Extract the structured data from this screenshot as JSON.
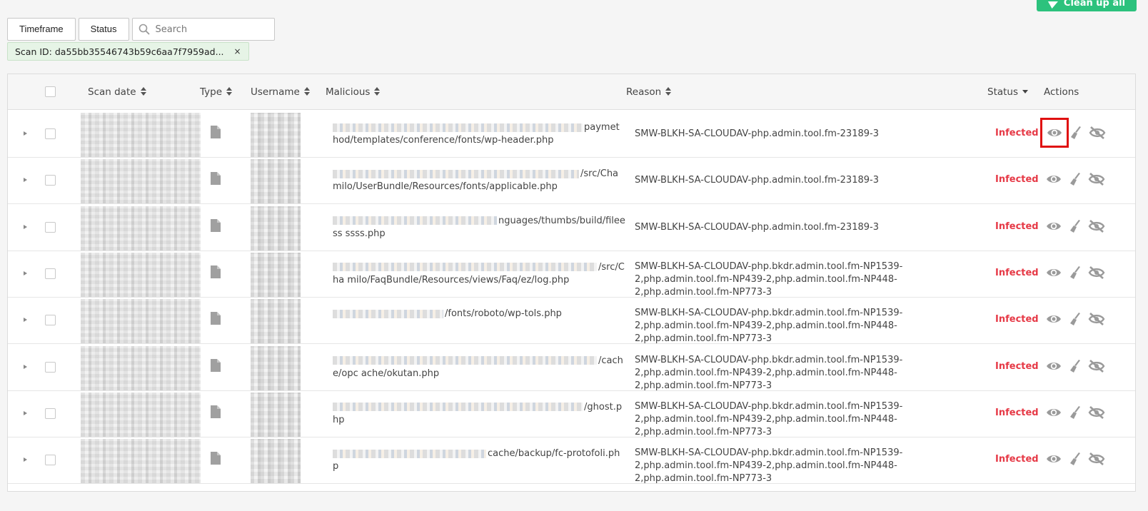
{
  "toolbar": {
    "cleanup_label": "Clean up all",
    "timeframe_label": "Timeframe",
    "status_label": "Status",
    "search_placeholder": "Search"
  },
  "filter_chip": {
    "label": "Scan ID: da55bb35546743b59c6aa7f7959ad...",
    "close": "×"
  },
  "columns": {
    "scan_date": "Scan date",
    "type": "Type",
    "username": "Username",
    "malicious": "Malicious",
    "reason": "Reason",
    "status": "Status",
    "actions": "Actions"
  },
  "rows": [
    {
      "malicious_visible": "paymet hod/templates/conference/fonts/wp-header.php",
      "reason": "SMW-BLKH-SA-CLOUDAV-php.admin.tool.fm-23189-3",
      "status": "Infected"
    },
    {
      "malicious_visible": "/src/Cha milo/UserBundle/Resources/fonts/applicable.php",
      "reason": "SMW-BLKH-SA-CLOUDAV-php.admin.tool.fm-23189-3",
      "status": "Infected"
    },
    {
      "malicious_visible": "nguages/thumbs/build/fileess ssss.php",
      "reason": "SMW-BLKH-SA-CLOUDAV-php.admin.tool.fm-23189-3",
      "status": "Infected"
    },
    {
      "malicious_visible": "/src/Cha milo/FaqBundle/Resources/views/Faq/ez/log.php",
      "reason": "SMW-BLKH-SA-CLOUDAV-php.bkdr.admin.tool.fm-NP1539-2,php.admin.tool.fm-NP439-2,php.admin.tool.fm-NP448-2,php.admin.tool.fm-NP773-3",
      "status": "Infected"
    },
    {
      "malicious_visible": "/fonts/roboto/wp-tols.php",
      "reason": "SMW-BLKH-SA-CLOUDAV-php.bkdr.admin.tool.fm-NP1539-2,php.admin.tool.fm-NP439-2,php.admin.tool.fm-NP448-2,php.admin.tool.fm-NP773-3",
      "status": "Infected"
    },
    {
      "malicious_visible": "/cache/opc ache/okutan.php",
      "reason": "SMW-BLKH-SA-CLOUDAV-php.bkdr.admin.tool.fm-NP1539-2,php.admin.tool.fm-NP439-2,php.admin.tool.fm-NP448-2,php.admin.tool.fm-NP773-3",
      "status": "Infected"
    },
    {
      "malicious_visible": "/ghost.php",
      "reason": "SMW-BLKH-SA-CLOUDAV-php.bkdr.admin.tool.fm-NP1539-2,php.admin.tool.fm-NP439-2,php.admin.tool.fm-NP448-2,php.admin.tool.fm-NP773-3",
      "status": "Infected"
    },
    {
      "malicious_visible": "cache/backup/fc-protofoli.php",
      "reason": "SMW-BLKH-SA-CLOUDAV-php.bkdr.admin.tool.fm-NP1539-2,php.admin.tool.fm-NP439-2,php.admin.tool.fm-NP448-2,php.admin.tool.fm-NP773-3",
      "status": "Infected"
    }
  ],
  "icons": {
    "view": "eye-icon",
    "clean": "broom-icon",
    "ignore": "eye-slash-icon",
    "file": "file-icon",
    "search": "search-icon"
  },
  "colors": {
    "infected": "#e63946",
    "accent": "#2cc27d",
    "highlight": "#e01010"
  }
}
